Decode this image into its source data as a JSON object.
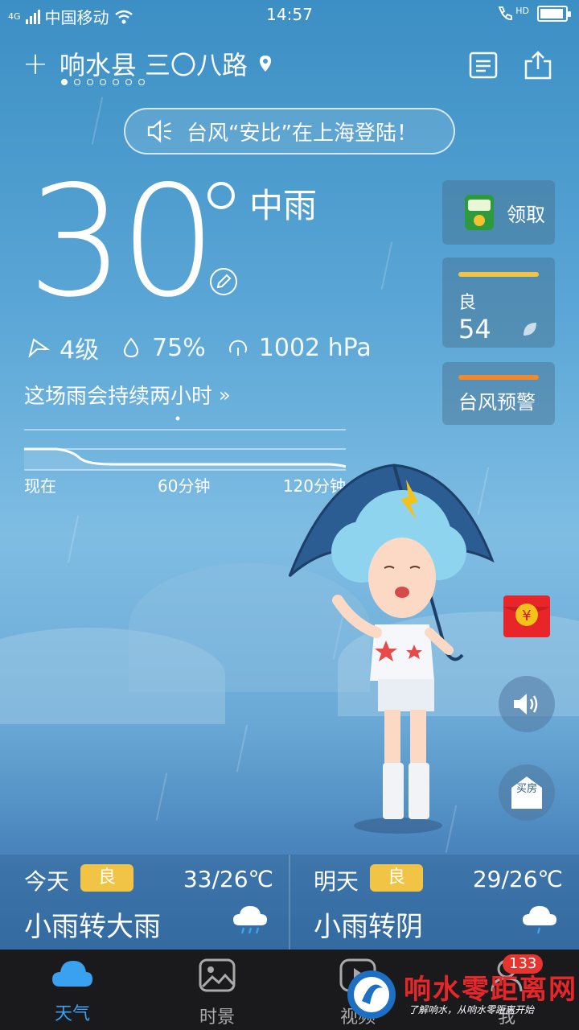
{
  "status_bar": {
    "network": "4G",
    "carrier": "中国移动",
    "time": "14:57",
    "hd": "HD"
  },
  "header": {
    "location": "响水县 三〇八路",
    "page_count": 7,
    "active_page": 1
  },
  "notice": {
    "text": "台风“安比”在上海登陆！"
  },
  "current": {
    "temperature": "30",
    "condition": "中雨",
    "wind": "4级",
    "humidity": "75%",
    "pressure": "1002 hPa",
    "rain_forecast": "这场雨会持续两小时",
    "timeline": {
      "now": "现在",
      "mid": "60分钟",
      "end": "120分钟"
    }
  },
  "side_cards": {
    "coupon_label": "领取",
    "aqi_label": "良",
    "aqi_value": "54",
    "warning_label": "台风预警",
    "house_icon_text": "买房"
  },
  "forecast": [
    {
      "day": "今天",
      "aqi": "良",
      "temp": "33/26℃",
      "desc": "小雨转大雨"
    },
    {
      "day": "明天",
      "aqi": "良",
      "temp": "29/26℃",
      "desc": "小雨转阴"
    }
  ],
  "tabs": [
    {
      "label": "天气",
      "active": true
    },
    {
      "label": "时景",
      "active": false
    },
    {
      "label": "视频",
      "active": false
    },
    {
      "label": "我",
      "active": false,
      "badge": "133"
    }
  ],
  "watermark": {
    "title": "响水零距离网",
    "subtitle": "了解响水，从响水零距离开始"
  },
  "colors": {
    "accent_blue": "#3aa0f0",
    "aqi_yellow": "#f1c445",
    "warning_orange": "#f08a2c",
    "badge_red": "#e8342f"
  }
}
